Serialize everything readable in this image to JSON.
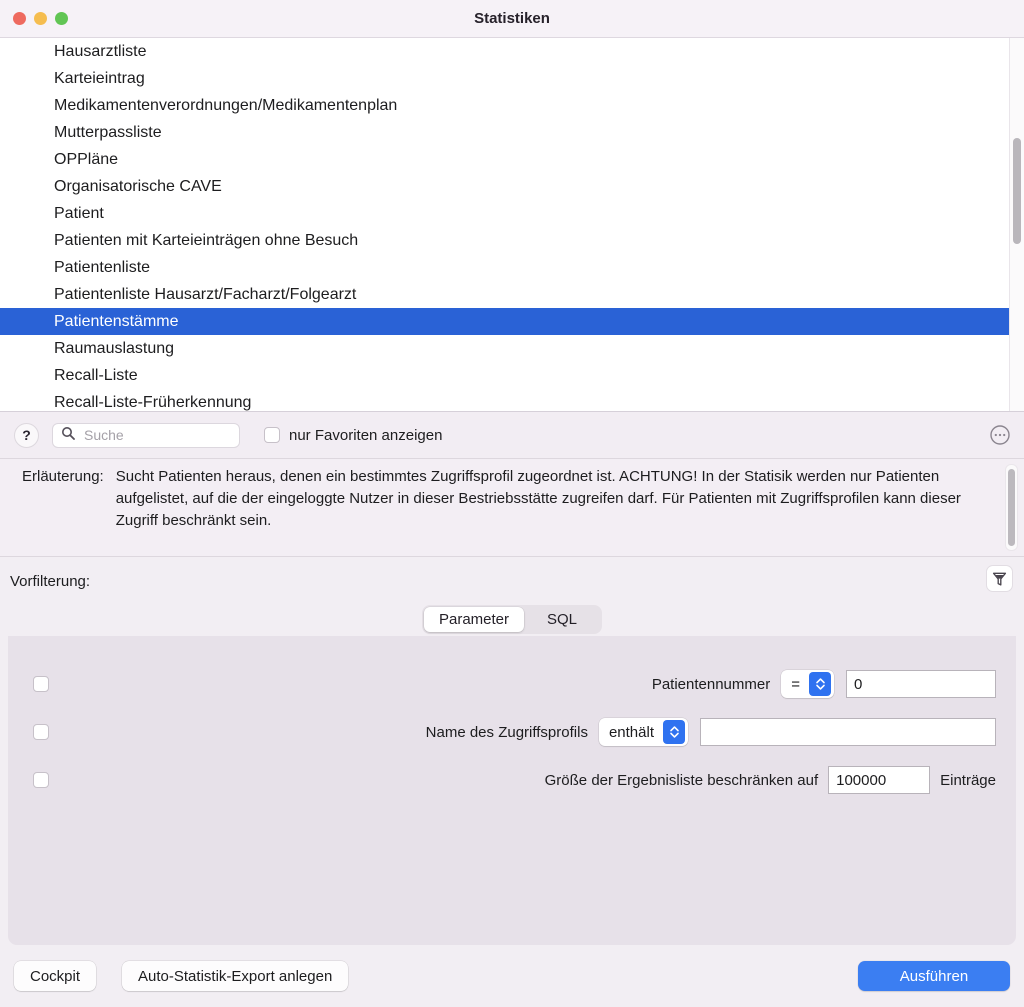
{
  "window": {
    "title": "Statistiken",
    "traffic_lights": [
      "close",
      "minimize",
      "maximize"
    ],
    "accent_color": "#2a62d6",
    "primary_button_color": "#3b7ef2"
  },
  "statistics_list": {
    "items": [
      {
        "label": "Hausarztliste",
        "selected": false
      },
      {
        "label": "Karteieintrag",
        "selected": false
      },
      {
        "label": "Medikamentenverordnungen/Medikamentenplan",
        "selected": false
      },
      {
        "label": "Mutterpassliste",
        "selected": false
      },
      {
        "label": "OPPläne",
        "selected": false
      },
      {
        "label": "Organisatorische CAVE",
        "selected": false
      },
      {
        "label": "Patient",
        "selected": false
      },
      {
        "label": "Patienten mit Karteieinträgen ohne Besuch",
        "selected": false
      },
      {
        "label": "Patientenliste",
        "selected": false
      },
      {
        "label": "Patientenliste Hausarzt/Facharzt/Folgearzt",
        "selected": false
      },
      {
        "label": "Patientenstämme",
        "selected": true
      },
      {
        "label": "Raumauslastung",
        "selected": false
      },
      {
        "label": "Recall-Liste",
        "selected": false
      },
      {
        "label": "Recall-Liste-Früherkennung",
        "selected": false
      }
    ]
  },
  "toolbar": {
    "help_label": "?",
    "search": {
      "value": "",
      "placeholder": "Suche"
    },
    "favorites_checkbox": {
      "label": "nur Favoriten anzeigen",
      "checked": false
    },
    "more_options_icon": "ellipsis-circle-icon"
  },
  "explanation": {
    "label": "Erläuterung:",
    "text": "Sucht Patienten heraus, denen ein bestimmtes Zugriffsprofil zugeordnet ist. ACHTUNG! In der Statisik werden nur Patienten aufgelistet, auf die der eingeloggte Nutzer in dieser Bestriebsstätte zugreifen darf. Für Patienten mit Zugriffsprofilen kann dieser Zugriff beschränkt sein."
  },
  "prefilter": {
    "label": "Vorfilterung:",
    "filter_icon": "funnel-icon"
  },
  "tabs": {
    "items": [
      {
        "label": "Parameter",
        "active": true
      },
      {
        "label": "SQL",
        "active": false
      }
    ]
  },
  "parameters": {
    "rows": [
      {
        "checked": false,
        "label": "Patientennummer",
        "operator": "=",
        "value": "0",
        "placeholder": ""
      },
      {
        "checked": false,
        "label": "Name des Zugriffsprofils",
        "operator": "enthält",
        "value": "",
        "placeholder": ""
      }
    ],
    "limit_row": {
      "checked": false,
      "label": "Größe der Ergebnisliste beschränken auf",
      "value": "100000",
      "unit": "Einträge"
    }
  },
  "footer": {
    "cockpit_label": "Cockpit",
    "auto_export_label": "Auto-Statistik-Export anlegen",
    "execute_label": "Ausführen"
  }
}
